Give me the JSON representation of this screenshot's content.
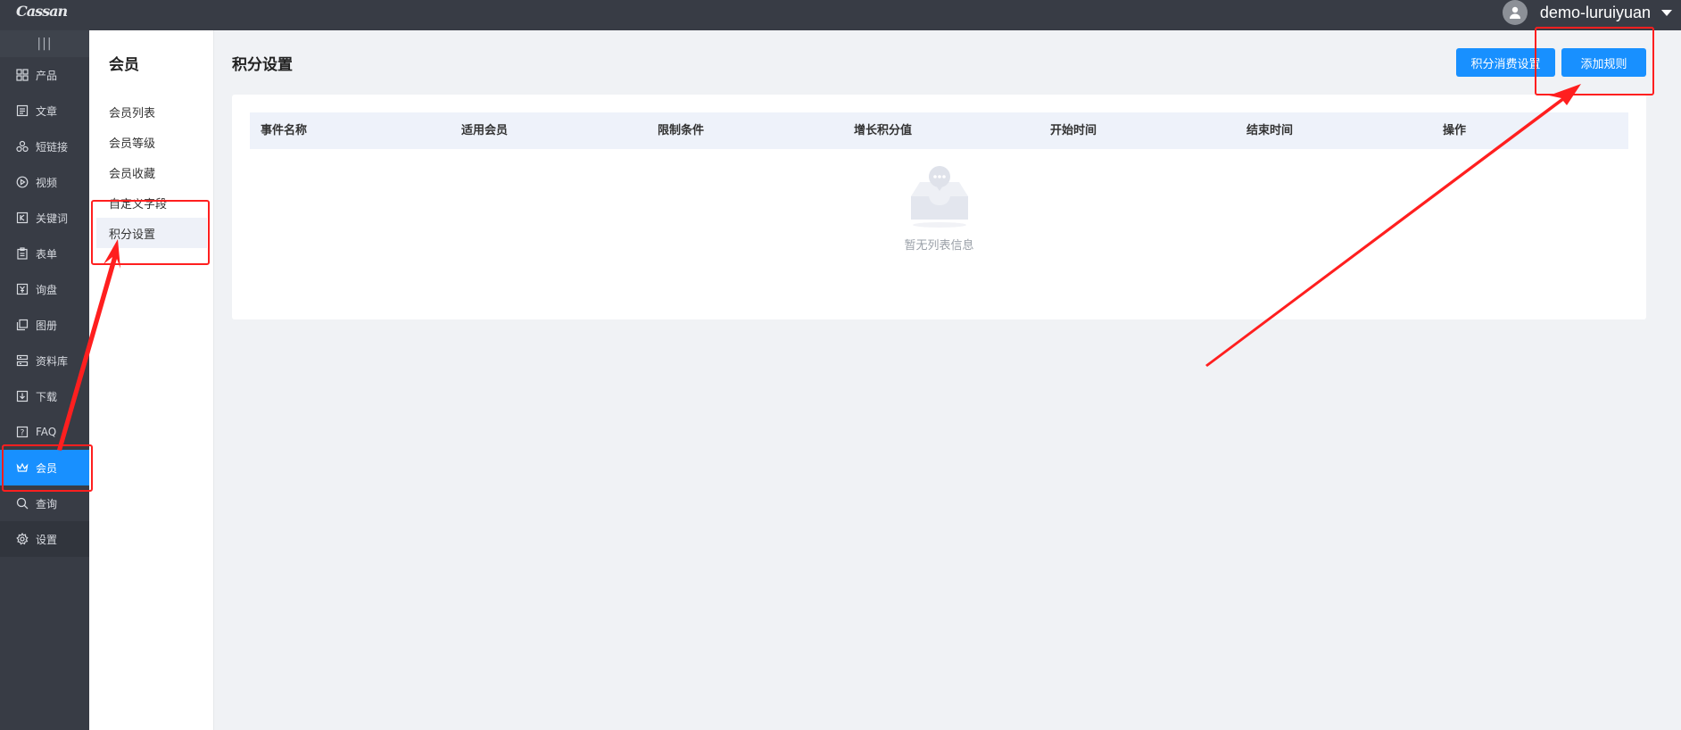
{
  "app": {
    "logo_text": "Cassan",
    "username": "demo-luruiyuan"
  },
  "sidebar": {
    "toggle_label": "|||",
    "items": [
      {
        "label": "产品",
        "icon": "grid-icon"
      },
      {
        "label": "文章",
        "icon": "article-icon"
      },
      {
        "label": "短链接",
        "icon": "link-icon"
      },
      {
        "label": "视频",
        "icon": "play-icon"
      },
      {
        "label": "关键词",
        "icon": "keyword-icon"
      },
      {
        "label": "表单",
        "icon": "clipboard-icon"
      },
      {
        "label": "询盘",
        "icon": "inquiry-icon"
      },
      {
        "label": "图册",
        "icon": "gallery-icon"
      },
      {
        "label": "资料库",
        "icon": "database-icon"
      },
      {
        "label": "下载",
        "icon": "download-icon"
      },
      {
        "label": "FAQ",
        "icon": "question-icon"
      },
      {
        "label": "会员",
        "icon": "crown-icon"
      },
      {
        "label": "查询",
        "icon": "search-icon"
      },
      {
        "label": "设置",
        "icon": "gear-icon"
      }
    ]
  },
  "submenu": {
    "title": "会员",
    "items": [
      {
        "label": "会员列表"
      },
      {
        "label": "会员等级"
      },
      {
        "label": "会员收藏"
      },
      {
        "label": "自定义字段"
      },
      {
        "label": "积分设置"
      }
    ]
  },
  "main": {
    "title": "积分设置",
    "points_consumption_button": "积分消费设置",
    "add_rule_button": "添加规则",
    "table": {
      "columns": [
        "事件名称",
        "适用会员",
        "限制条件",
        "增长积分值",
        "开始时间",
        "结束时间",
        "操作"
      ],
      "rows": []
    },
    "empty_text": "暂无列表信息"
  },
  "colors": {
    "accent": "#1890ff",
    "topbar": "#383c45",
    "annotation": "#ff1f1f"
  }
}
